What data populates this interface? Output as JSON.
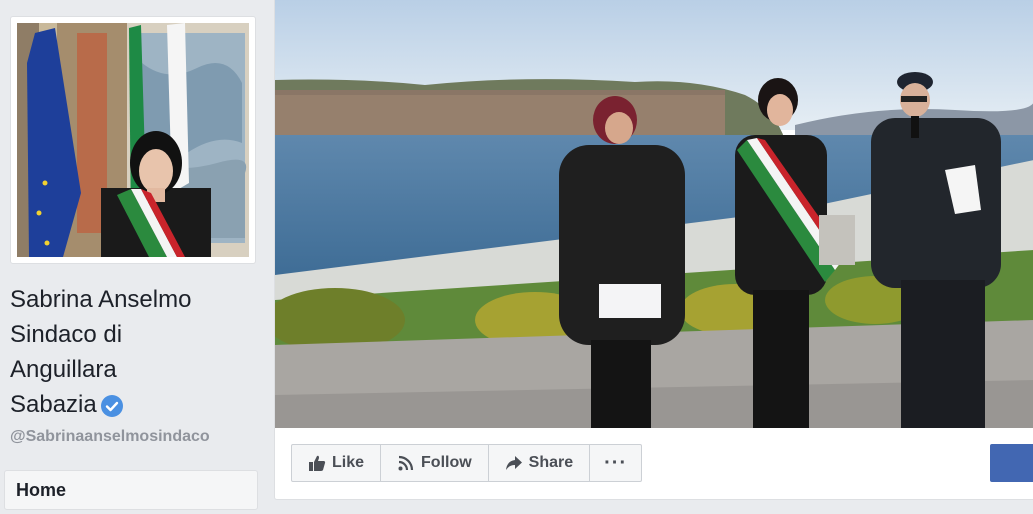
{
  "profile": {
    "name_lines": [
      "Sabrina Anselmo",
      "Sindaco di",
      "Anguillara",
      "Sabazia"
    ],
    "username": "@Sabrinaanselmosindaco",
    "verified": true
  },
  "nav": {
    "home_label": "Home"
  },
  "actions": {
    "like_label": "Like",
    "follow_label": "Follow",
    "share_label": "Share",
    "more_label": "···"
  },
  "icons": {
    "verified": "verified-badge-icon",
    "like": "thumbs-up-icon",
    "follow": "rss-follow-icon",
    "share": "share-arrow-icon",
    "more": "more-dots-icon"
  },
  "colors": {
    "brand_blue": "#4267b2",
    "verified_blue": "#4a90e2",
    "background": "#e9ebee"
  }
}
